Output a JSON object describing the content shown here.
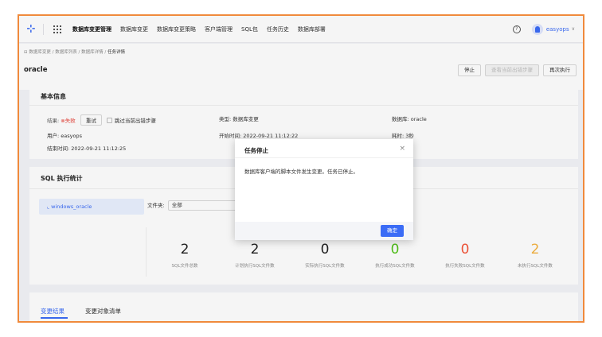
{
  "nav": {
    "items": [
      "数据库变更管理",
      "数据库变更",
      "数据库变更策略",
      "客户端管理",
      "SQL包",
      "任务历史",
      "数据库部署"
    ],
    "user": "easyops",
    "help_icon": "question-circle-icon",
    "logo_icon": "brand-logo-icon"
  },
  "breadcrumb": [
    "数据库变更",
    "数据库列表",
    "数据库详情",
    "任务详情"
  ],
  "page": {
    "title": "oracle",
    "actions": {
      "stop": "停止",
      "view_error_step": "查看当前出错步骤",
      "rerun": "再次执行"
    }
  },
  "basic": {
    "title": "基本信息",
    "result_label": "结果:",
    "result_value": "失败",
    "retry": "重试",
    "skip": "跳过当前出错步骤",
    "type": "类型: 数据库变更",
    "db": "数据库: oracle",
    "user": "用户: easyops",
    "start": "开始时间: 2022-09-21 11:12:22",
    "duration": "耗时: 3秒",
    "end": "结束时间: 2022-09-21 11:12:25"
  },
  "sql": {
    "title": "SQL 执行统计",
    "file_item": "windows_oracle",
    "folder_label": "文件夹:",
    "folder_value": "全部",
    "stats": [
      {
        "value": "2",
        "label": "SQL文件总数",
        "color": "#222222"
      },
      {
        "value": "2",
        "label": "计划执行SQL文件数",
        "color": "#222222"
      },
      {
        "value": "0",
        "label": "实际执行SQL文件数",
        "color": "#222222"
      },
      {
        "value": "0",
        "label": "执行成功SQL文件数",
        "color": "#52c41a"
      },
      {
        "value": "0",
        "label": "执行失败SQL文件数",
        "color": "#f5563a"
      },
      {
        "value": "2",
        "label": "未执行SQL文件数",
        "color": "#f5b342"
      }
    ]
  },
  "tabs": [
    "变更结果",
    "变更对象清单"
  ],
  "modal": {
    "title": "任务停止",
    "message": "数据库客户端的脚本文件发生变更。任务已停止。",
    "ok": "确定"
  }
}
